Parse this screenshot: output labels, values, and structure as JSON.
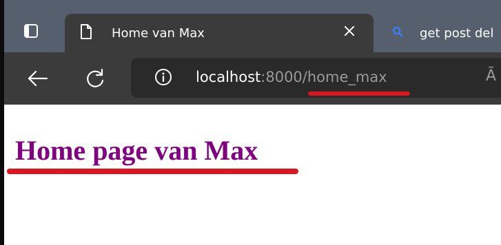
{
  "browser": {
    "tabs": [
      {
        "title": "Home van Max",
        "icon": "page-icon",
        "active": true
      },
      {
        "title": "get post del",
        "icon": "search-icon",
        "active": false
      }
    ],
    "toolbar": {
      "back_icon": "arrow-left-icon",
      "refresh_icon": "refresh-icon",
      "info_icon": "info-icon"
    },
    "address": {
      "host": "localhost",
      "rest": ":8000/home_max",
      "read_aloud_glyph": "Ã"
    }
  },
  "page": {
    "heading": "Home page van Max"
  },
  "annotations": {
    "highlight_color": "#e0141e"
  },
  "colors": {
    "tabstrip": "#555f6e",
    "toolbar": "#3b3b3b",
    "heading": "#800080"
  }
}
